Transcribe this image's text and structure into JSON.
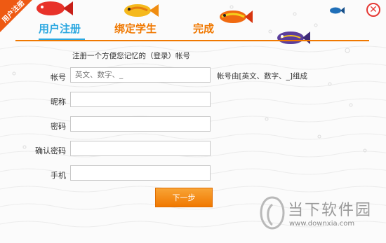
{
  "window": {
    "corner_badge": "用户注册",
    "close_icon": "close-icon"
  },
  "tabs": [
    {
      "label": "用户注册",
      "active": true
    },
    {
      "label": "绑定学生",
      "active": false
    },
    {
      "label": "完成",
      "active": false
    }
  ],
  "form": {
    "intro": "注册一个方便您记忆的（登录）帐号",
    "account": {
      "label": "帐号",
      "placeholder": "英文、数字、_",
      "hint": "帐号由[英文、数字、_]组成"
    },
    "nickname": {
      "label": "昵称",
      "placeholder": ""
    },
    "password": {
      "label": "密码",
      "placeholder": ""
    },
    "confirm_password": {
      "label": "确认密码",
      "placeholder": ""
    },
    "phone": {
      "label": "手机",
      "placeholder": ""
    },
    "next_button": "下一步"
  },
  "watermark": {
    "title": "当下软件园",
    "url": "www.downxia.com"
  },
  "colors": {
    "accent_orange": "#f07800",
    "active_tab_blue": "#2aa7e0",
    "close_red": "#e53935"
  }
}
